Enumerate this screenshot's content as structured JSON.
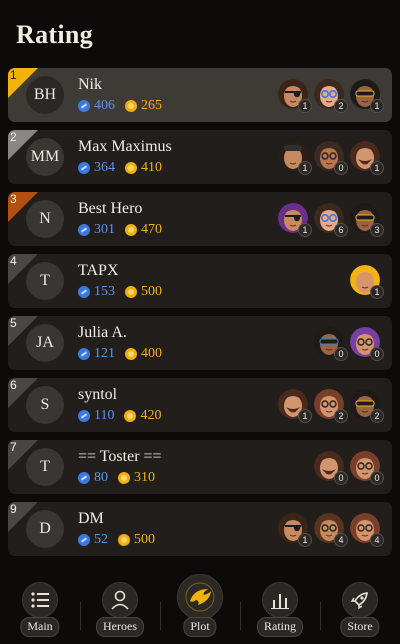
{
  "header": {
    "title": "Rating"
  },
  "colors": {
    "xp": "#3b7be0",
    "coin": "#f0ae10",
    "gold": "#f0b20c",
    "silver": "#8a8782",
    "bronze": "#b4500f"
  },
  "players": [
    {
      "rank": "1",
      "initials": "BH",
      "name": "Nik",
      "xp": "406",
      "coins": "265",
      "heroes": [
        {
          "skin": "#c98a62",
          "hair": "#3a2516",
          "acc": "eyepatch",
          "count": "1"
        },
        {
          "skin": "#e7a98a",
          "hair": "#3a2a1d",
          "acc": "glasses-blue",
          "count": "2"
        },
        {
          "skin": "#9a6444",
          "hair": "#1d1a17",
          "acc": "shades-yellow",
          "count": "1"
        }
      ]
    },
    {
      "rank": "2",
      "initials": "MM",
      "name": "Max Maximus",
      "xp": "364",
      "coins": "410",
      "heroes": [
        {
          "skin": "#c58a5e",
          "hair": "#2a1f18",
          "acc": "cap",
          "count": "1"
        },
        {
          "skin": "#b8774f",
          "hair": "#3a2b22",
          "acc": "glasses-black",
          "count": "0"
        },
        {
          "skin": "#d19670",
          "hair": "#4a2a1c",
          "acc": "beard",
          "count": "1"
        }
      ]
    },
    {
      "rank": "3",
      "initials": "N",
      "name": "Best Hero",
      "xp": "301",
      "coins": "470",
      "heroes": [
        {
          "skin": "#c98a62",
          "hair": "#6a2e8c",
          "acc": "eyepatch",
          "count": "1"
        },
        {
          "skin": "#e7a98a",
          "hair": "#3a2a1d",
          "acc": "glasses-blue",
          "count": "6"
        },
        {
          "skin": "#9a6444",
          "hair": "#1d1a17",
          "acc": "shades-yellow",
          "count": "3"
        }
      ]
    },
    {
      "rank": "4",
      "initials": "T",
      "name": "TAPX",
      "xp": "153",
      "coins": "500",
      "heroes": [
        {
          "skin": "#d9956a",
          "hair": "#f3b413",
          "acc": "none",
          "count": "1"
        }
      ]
    },
    {
      "rank": "5",
      "initials": "JA",
      "name": "Julia A.",
      "xp": "121",
      "coins": "400",
      "heroes": [
        {
          "skin": "#9a6444",
          "hair": "#1d1a17",
          "acc": "shades-blue",
          "count": "0"
        },
        {
          "skin": "#d4956d",
          "hair": "#7a3fa3",
          "acc": "glasses-black",
          "count": "0"
        }
      ]
    },
    {
      "rank": "6",
      "initials": "S",
      "name": "syntol",
      "xp": "110",
      "coins": "420",
      "heroes": [
        {
          "skin": "#d19670",
          "hair": "#4a2a1c",
          "acc": "beard",
          "count": "1"
        },
        {
          "skin": "#d4956d",
          "hair": "#7a3f2a",
          "acc": "glasses-black",
          "count": "2"
        },
        {
          "skin": "#9a6444",
          "hair": "#1d1a17",
          "acc": "shades-yellow",
          "count": "2"
        }
      ]
    },
    {
      "rank": "7",
      "initials": "T",
      "name": "== Toster ==",
      "xp": "80",
      "coins": "310",
      "heroes": [
        {
          "skin": "#d19670",
          "hair": "#4a2a1c",
          "acc": "beard",
          "count": "0"
        },
        {
          "skin": "#d4956d",
          "hair": "#7a3f2a",
          "acc": "glasses-black",
          "count": "0"
        }
      ]
    },
    {
      "rank": "9",
      "initials": "D",
      "name": "DM",
      "xp": "52",
      "coins": "500",
      "heroes": [
        {
          "skin": "#c98a62",
          "hair": "#3a2516",
          "acc": "eyepatch",
          "count": "1"
        },
        {
          "skin": "#c58a5e",
          "hair": "#5a3320",
          "acc": "glasses-black",
          "count": "4"
        },
        {
          "skin": "#d4956d",
          "hair": "#7a3f2a",
          "acc": "glasses-black",
          "count": "4"
        }
      ]
    }
  ],
  "nav": {
    "items": [
      {
        "label": "Main",
        "icon": "list-icon"
      },
      {
        "label": "Heroes",
        "icon": "person-icon"
      },
      {
        "label": "Plot",
        "icon": "plot-icon"
      },
      {
        "label": "Rating",
        "icon": "bar-chart-icon"
      },
      {
        "label": "Store",
        "icon": "rocket-icon"
      }
    ]
  }
}
